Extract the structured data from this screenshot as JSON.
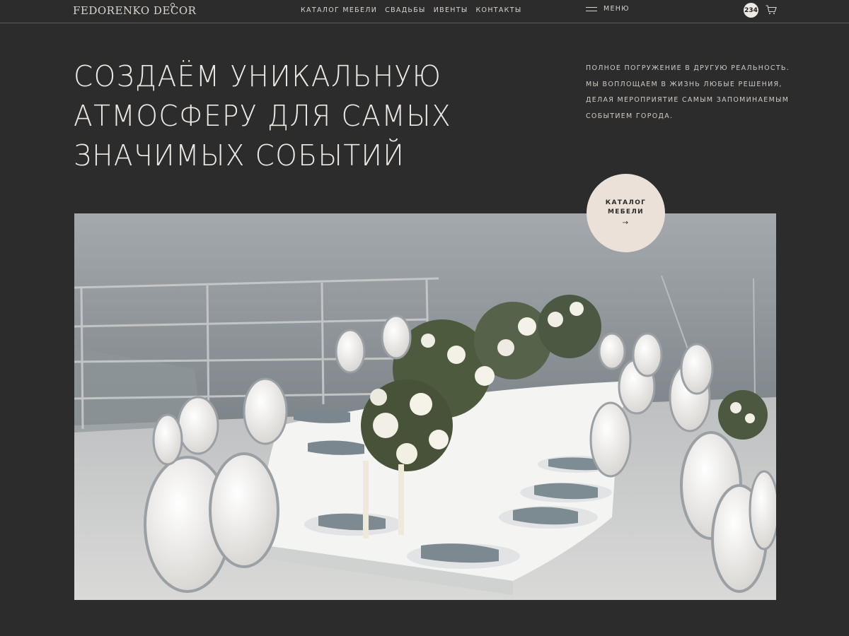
{
  "brand": {
    "logo_text": "FEDORENKO DECOR"
  },
  "nav": {
    "items": [
      {
        "label": "КАТАЛОГ МЕБЕЛИ"
      },
      {
        "label": "СВАДЬБЫ"
      },
      {
        "label": "ИВЕНТЫ"
      },
      {
        "label": "КОНТАКТЫ"
      }
    ],
    "menu_label": "МЕНЮ"
  },
  "cart": {
    "count": "234"
  },
  "hero": {
    "headline": [
      "СОЗДАЁМ УНИКАЛЬНУЮ",
      "АТМОСФЕРУ ДЛЯ  САМЫХ",
      "ЗНАЧИМЫХ СОБЫТИЙ"
    ],
    "lead": [
      "ПОЛНОЕ ПОГРУЖЕНИЕ В ДРУГУЮ РЕАЛЬНОСТЬ.",
      "МЫ ВОПЛОЩАЕМ В ЖИЗНЬ ЛЮБЫЕ РЕШЕНИЯ,",
      "ДЕЛАЯ МЕРОПРИЯТИЕ САМЫМ ЗАПОМИНАЕМЫМ",
      "СОБЫТИЕМ ГОРОДА."
    ],
    "cta": {
      "line1": "КАТАЛОГ",
      "line2": "МЕБЕЛИ",
      "arrow": "→"
    }
  },
  "colors": {
    "background": "#2c2c2c",
    "text": "#ece8e4",
    "cta_bg": "#ebe1d9",
    "badge_bg": "#efe9e3"
  },
  "icons": {
    "menu": "hamburger-icon",
    "cart": "cart-icon",
    "cta_arrow": "arrow-right-icon"
  }
}
